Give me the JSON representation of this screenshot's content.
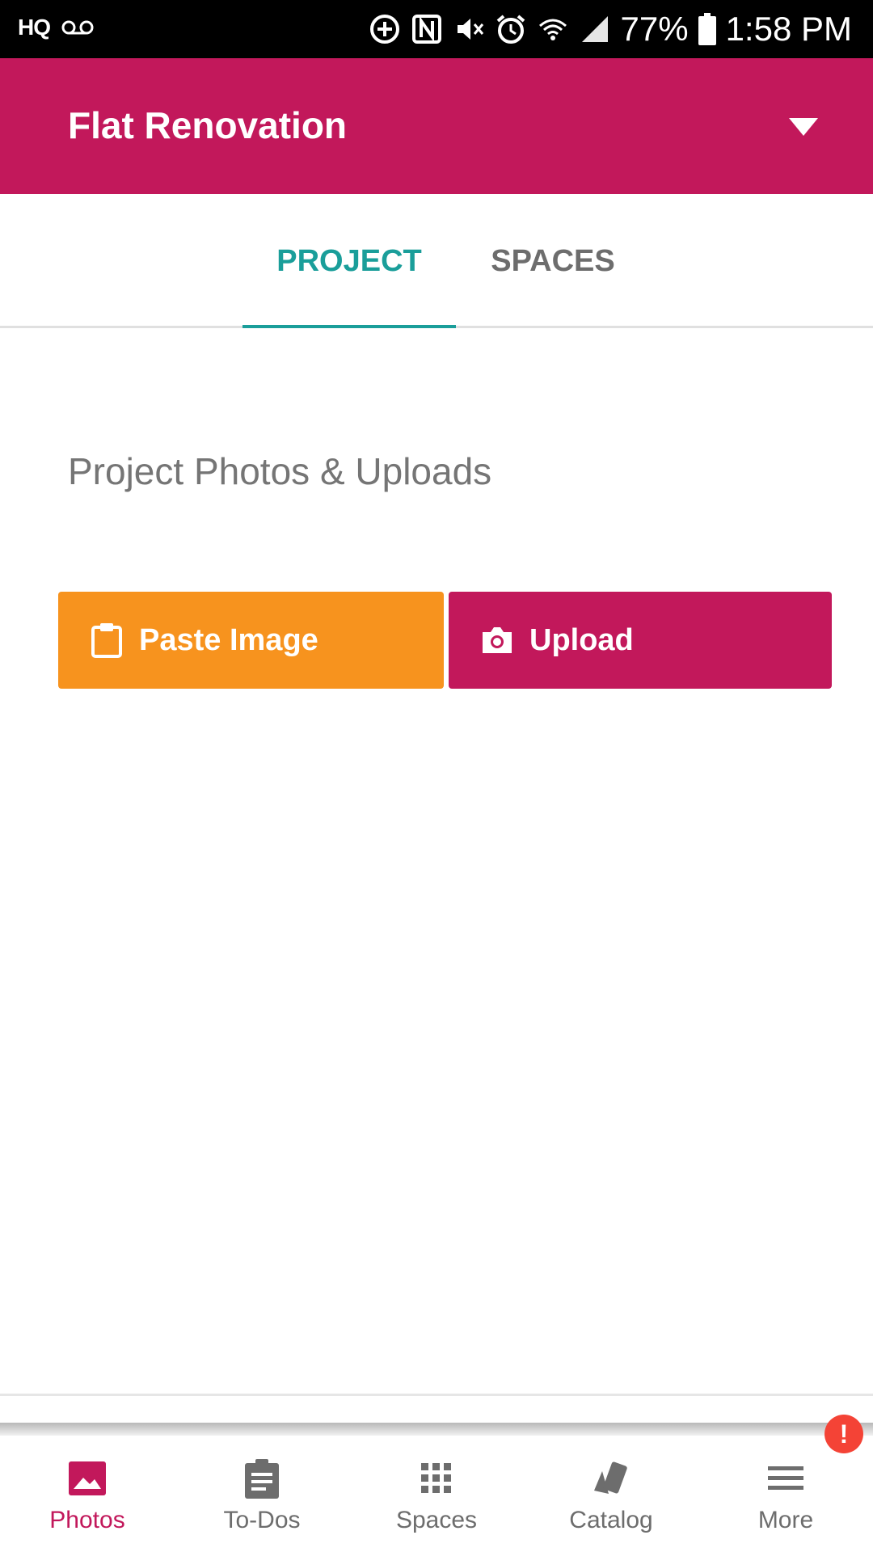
{
  "status_bar": {
    "left_text": "HQ",
    "battery": "77%",
    "time": "1:58 PM",
    "icons": [
      "voicemail-icon",
      "data-saver-icon",
      "nfc-icon",
      "vibrate-icon",
      "alarm-icon",
      "wifi-icon",
      "signal-icon",
      "battery-icon"
    ]
  },
  "app_bar": {
    "title": "Flat Renovation",
    "background": "#C2185B"
  },
  "tabs": [
    {
      "label": "PROJECT",
      "active": true
    },
    {
      "label": "SPACES",
      "active": false
    }
  ],
  "content": {
    "section_title": "Project Photos & Uploads",
    "paste_button": {
      "label": "Paste Image",
      "icon": "clipboard-icon",
      "color": "#F7931E"
    },
    "upload_button": {
      "label": "Upload",
      "icon": "camera-icon",
      "color": "#C2185B"
    }
  },
  "bottom_nav": {
    "items": [
      {
        "label": "Photos",
        "icon": "photo-icon",
        "active": true
      },
      {
        "label": "To-Dos",
        "icon": "clipboard-list-icon",
        "active": false
      },
      {
        "label": "Spaces",
        "icon": "grid-icon",
        "active": false
      },
      {
        "label": "Catalog",
        "icon": "swatches-icon",
        "active": false
      },
      {
        "label": "More",
        "icon": "menu-icon",
        "active": false
      }
    ],
    "alert_badge": "!"
  },
  "colors": {
    "accent_teal": "#1A9E9A",
    "brand_magenta": "#C2185B",
    "orange": "#F7931E",
    "alert_red": "#F44336"
  }
}
